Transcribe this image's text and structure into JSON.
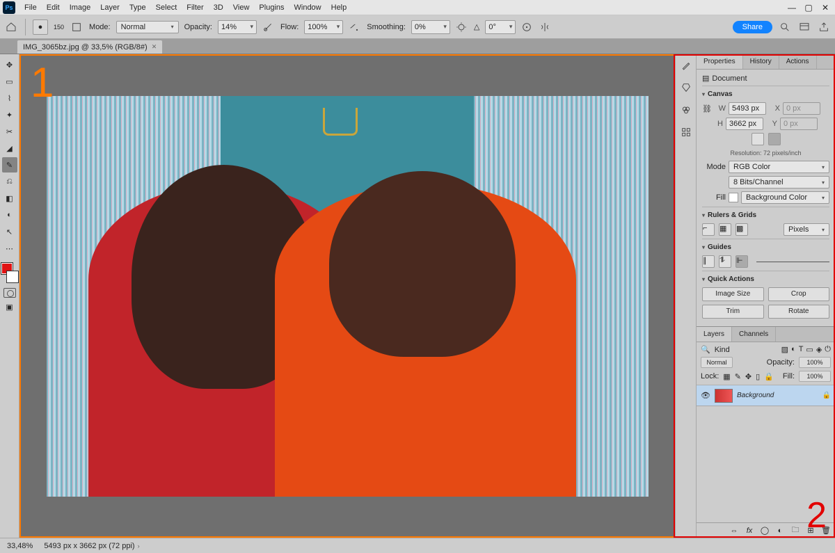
{
  "menu": {
    "items": [
      "File",
      "Edit",
      "Image",
      "Layer",
      "Type",
      "Select",
      "Filter",
      "3D",
      "View",
      "Plugins",
      "Window",
      "Help"
    ]
  },
  "options": {
    "brush_size": "150",
    "mode_label": "Mode:",
    "mode": "Normal",
    "opacity_label": "Opacity:",
    "opacity": "14%",
    "flow_label": "Flow:",
    "flow": "100%",
    "smoothing_label": "Smoothing:",
    "smoothing": "0%",
    "angle_label": "△",
    "angle": "0°",
    "share": "Share"
  },
  "tab": {
    "label": "IMG_3065bz.jpg @ 33,5% (RGB/8#)"
  },
  "toolbar": {
    "fg": "#e01313",
    "bg": "#ffffff"
  },
  "annotations": {
    "n1": "1",
    "n2": "2"
  },
  "panels": {
    "tabs": [
      "Properties",
      "History",
      "Actions"
    ],
    "docType": "Document",
    "canvas": {
      "title": "Canvas",
      "w_label": "W",
      "w": "5493 px",
      "x_label": "X",
      "x": "0 px",
      "h_label": "H",
      "h": "3662 px",
      "y_label": "Y",
      "y": "0 px",
      "resolution": "Resolution: 72 pixels/inch",
      "mode_label": "Mode",
      "mode": "RGB Color",
      "depth": "8 Bits/Channel",
      "fill_label": "Fill",
      "fill": "Background Color"
    },
    "rulers": {
      "title": "Rulers & Grids",
      "units": "Pixels"
    },
    "guides": {
      "title": "Guides"
    },
    "quick": {
      "title": "Quick Actions",
      "b1": "Image Size",
      "b2": "Crop",
      "b3": "Trim",
      "b4": "Rotate"
    }
  },
  "layers": {
    "tabs": [
      "Layers",
      "Channels"
    ],
    "kind": "Kind",
    "blend": "Normal",
    "opacity_label": "Opacity:",
    "opacity": "100%",
    "lock_label": "Lock:",
    "fill_label": "Fill:",
    "fill": "100%",
    "item": {
      "name": "Background"
    }
  },
  "status": {
    "zoom": "33,48%",
    "dims": "5493 px x 3662 px (72 ppi)"
  }
}
